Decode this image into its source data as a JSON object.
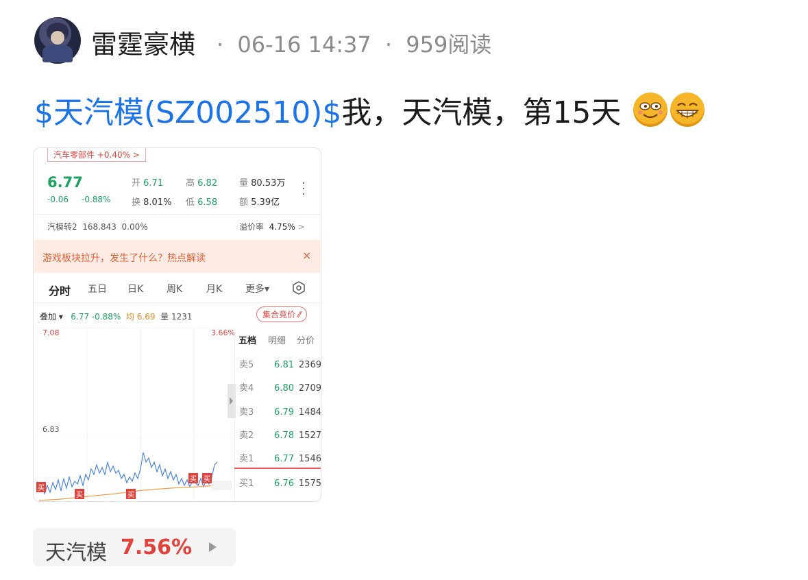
{
  "header": {
    "username": "雷霆豪横",
    "sep1": "·",
    "datetime": "06-16 14:37",
    "sep2": "·",
    "reads": "959阅读"
  },
  "post": {
    "stock_link": "$天汽模(SZ002510)$",
    "text": "我，天汽模，第15天",
    "emojis": [
      "grinning-face-emoji",
      "beaming-face-emoji"
    ]
  },
  "card": {
    "sector": "汽车零部件 +0.40% >",
    "price": "6.77",
    "change": "-0.06",
    "change_pct": "-0.88%",
    "stats": {
      "open_label": "开",
      "open": "6.71",
      "high_label": "高",
      "high": "6.82",
      "vol_label": "量",
      "vol": "80.53万",
      "turnover_label": "换",
      "turnover": "8.01%",
      "low_label": "低",
      "low": "6.58",
      "amount_label": "额",
      "amount": "5.39亿"
    },
    "bond": {
      "name": "汽模转2",
      "price": "168.843",
      "pct": "0.00%",
      "premium_label": "溢价率",
      "premium": "4.75%",
      "arrow": ">"
    },
    "banner": {
      "text": "游戏板块拉升，发生了什么？热点解读",
      "close": "×"
    },
    "tabs": [
      "分时",
      "五日",
      "日K",
      "周K",
      "月K",
      "更多▾"
    ],
    "overlay": {
      "label": "叠加 ▾",
      "price": "6.77",
      "pct": "-0.88%",
      "avg_label": "均",
      "avg": "6.69",
      "vol_label": "量",
      "vol": "1231"
    },
    "auction_btn": "集合竞价 ⁄⁄",
    "chart_labels": {
      "top_price": "7.08",
      "top_pct": "3.66%",
      "mid_price": "6.83",
      "buy_marker": "买"
    },
    "orderbook_tabs": [
      "五档",
      "明细",
      "分价"
    ],
    "orderbook": [
      {
        "side": "卖5",
        "price": "6.81",
        "vol": "2369"
      },
      {
        "side": "卖4",
        "price": "6.80",
        "vol": "2709"
      },
      {
        "side": "卖3",
        "price": "6.79",
        "vol": "1484"
      },
      {
        "side": "卖2",
        "price": "6.78",
        "vol": "1527"
      },
      {
        "side": "卖1",
        "price": "6.77",
        "vol": "1546"
      },
      {
        "side": "买1",
        "price": "6.76",
        "vol": "1575"
      }
    ]
  },
  "bottom": {
    "name": "天汽模",
    "pct": "7.56%"
  },
  "colors": {
    "link": "#1a73e8",
    "up": "#e0423c",
    "down": "#1aa260"
  }
}
